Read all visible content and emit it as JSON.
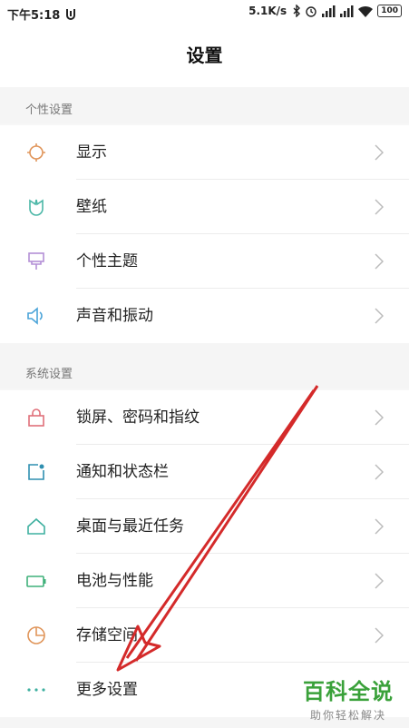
{
  "status_bar": {
    "time": "下午5:18",
    "net_speed": "5.1K/s",
    "battery": "100"
  },
  "header": {
    "title": "设置"
  },
  "sections": [
    {
      "label": "个性设置",
      "items": [
        {
          "label": "显示",
          "icon": "sun-icon",
          "color": "#e0955a"
        },
        {
          "label": "壁纸",
          "icon": "wallpaper-icon",
          "color": "#4bb7a7"
        },
        {
          "label": "个性主题",
          "icon": "brush-icon",
          "color": "#b48fd6"
        },
        {
          "label": "声音和振动",
          "icon": "speaker-icon",
          "color": "#4aa3d8"
        }
      ]
    },
    {
      "label": "系统设置",
      "items": [
        {
          "label": "锁屏、密码和指纹",
          "icon": "lock-icon",
          "color": "#e0707a"
        },
        {
          "label": "通知和状态栏",
          "icon": "notification-icon",
          "color": "#2f8fb0"
        },
        {
          "label": "桌面与最近任务",
          "icon": "home-icon",
          "color": "#3fb0a0"
        },
        {
          "label": "电池与性能",
          "icon": "battery-icon",
          "color": "#3fb07a"
        },
        {
          "label": "存储空间",
          "icon": "storage-pie-icon",
          "color": "#e0955a"
        },
        {
          "label": "更多设置",
          "icon": "more-dots-icon",
          "color": "#3fb0a0"
        }
      ]
    }
  ],
  "watermark": {
    "logo": "百科全说",
    "sub": "助你轻松解决"
  },
  "annotation_color": "#d42a2a"
}
